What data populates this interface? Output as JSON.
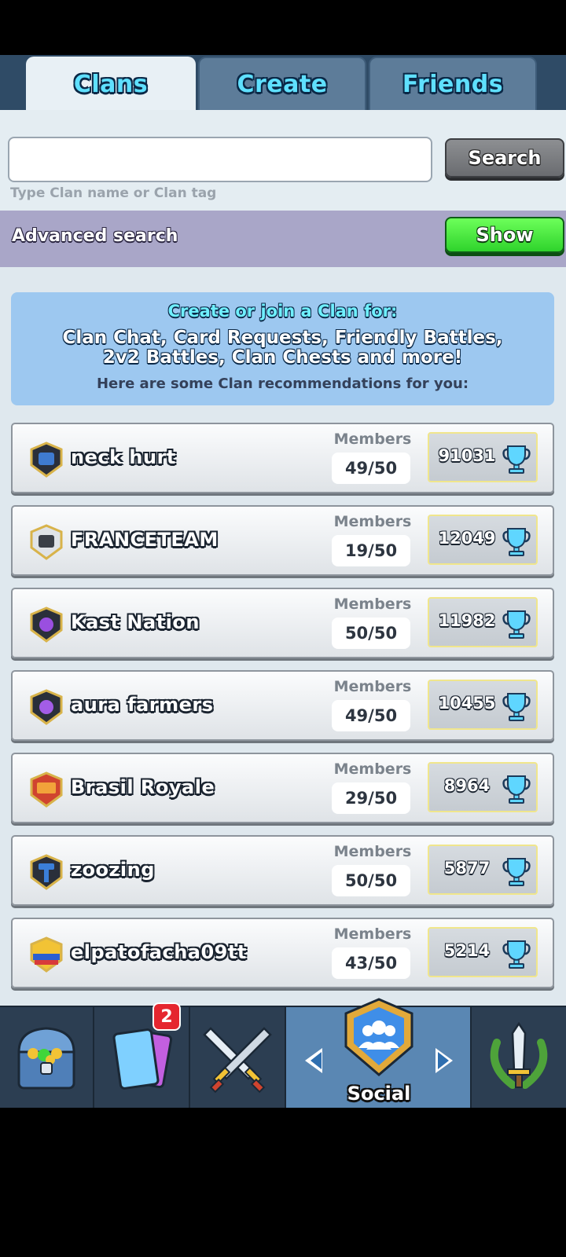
{
  "tabs": [
    {
      "label": "Clans",
      "active": true
    },
    {
      "label": "Create",
      "active": false
    },
    {
      "label": "Friends",
      "active": false
    }
  ],
  "search": {
    "value": "",
    "placeholder": "",
    "hint": "Type Clan name or Clan tag",
    "button_label": "Search"
  },
  "advanced": {
    "label": "Advanced search",
    "button_label": "Show"
  },
  "info": {
    "title": "Create or join a Clan for:",
    "body_line1": "Clan Chat, Card Requests, Friendly Battles,",
    "body_line2": "2v2 Battles, Clan Chests and more!",
    "footer": "Here are some Clan recommendations for you:"
  },
  "clans": [
    {
      "name": "neck hurt",
      "members_label": "Members",
      "members": "49/50",
      "trophies": "91031",
      "badge_color": "#3f7bd0"
    },
    {
      "name": "FRANCETEAM",
      "members_label": "Members",
      "members": "19/50",
      "trophies": "12049",
      "badge_color": "#e0e3e7"
    },
    {
      "name": "Kast Nation",
      "members_label": "Members",
      "members": "50/50",
      "trophies": "11982",
      "badge_color": "#7a3fd0"
    },
    {
      "name": "aura farmers",
      "members_label": "Members",
      "members": "49/50",
      "trophies": "10455",
      "badge_color": "#8a44d6"
    },
    {
      "name": "Brasil Royale",
      "members_label": "Members",
      "members": "29/50",
      "trophies": "8964",
      "badge_color": "#d0442f"
    },
    {
      "name": "zoozing",
      "members_label": "Members",
      "members": "50/50",
      "trophies": "5877",
      "badge_color": "#3b7fd8"
    },
    {
      "name": "elpatofacha09tt",
      "members_label": "Members",
      "members": "43/50",
      "trophies": "5214",
      "badge_color": "#f2c335"
    }
  ],
  "nav": {
    "items": [
      {
        "icon": "chest-icon"
      },
      {
        "icon": "cards-icon",
        "badge": "2"
      },
      {
        "icon": "crossed-swords-icon"
      },
      {
        "icon": "social-icon",
        "label": "Social"
      },
      {
        "icon": "laurel-sword-icon"
      }
    ]
  },
  "colors": {
    "tab_text": "#5fe0ff",
    "search_button": "#7a7c80",
    "show_button": "#3fd63a",
    "info_bg": "#9dc8f0",
    "advanced_bg": "#a9a6c8",
    "nav_active": "#5a87b3"
  }
}
